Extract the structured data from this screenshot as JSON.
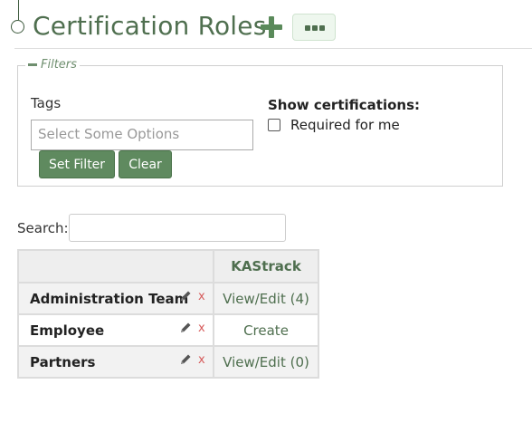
{
  "header": {
    "title": "Certification Roles",
    "add_icon": "plus-icon",
    "more_icon": "ellipsis-icon"
  },
  "filters": {
    "legend": "Filters",
    "tags_label": "Tags",
    "tags_placeholder": "Select Some Options",
    "set_filter_label": "Set Filter",
    "clear_label": "Clear",
    "show_cert_label": "Show certifications:",
    "required_label": "Required for me",
    "required_checked": false
  },
  "search": {
    "label": "Search:",
    "value": ""
  },
  "table": {
    "columns": [
      "KAStrack"
    ],
    "rows": [
      {
        "name": "Administration Team",
        "cells": [
          "View/Edit (4)"
        ]
      },
      {
        "name": "Employee",
        "cells": [
          "Create"
        ]
      },
      {
        "name": "Partners",
        "cells": [
          "View/Edit (0)"
        ]
      }
    ],
    "delete_label": "x"
  },
  "colors": {
    "accent": "#4f6f4f",
    "button": "#5f8a5f",
    "delete": "#d65c5c"
  }
}
